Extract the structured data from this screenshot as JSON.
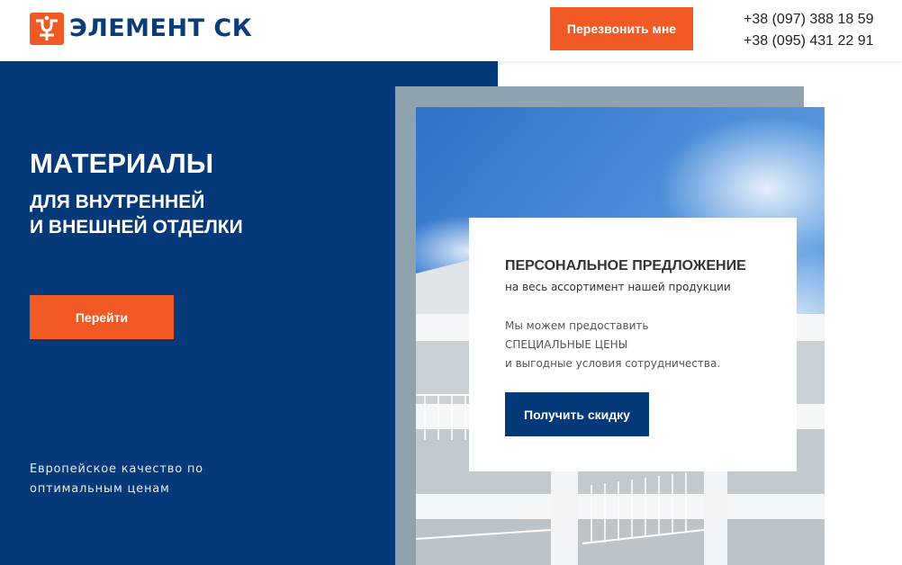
{
  "header": {
    "logo_text": "ЭЛЕМЕНТ СК",
    "callback_label": "Перезвонить мне",
    "phones": [
      "+38 (097) 388 18 59",
      "+38 (095) 431 22 91"
    ]
  },
  "hero": {
    "title": "МАТЕРИАЛЫ",
    "subtitle_lines": [
      "ДЛЯ ВНУТРЕННЕЙ",
      "И ВНЕШНЕЙ ОТДЕЛКИ"
    ],
    "go_label": "Перейти",
    "note_lines": [
      "Европейское качество по",
      "оптимальным ценам"
    ]
  },
  "offer": {
    "title": "ПЕРСОНАЛЬНОЕ ПРЕДЛОЖЕНИЕ",
    "subtitle": "на весь ассортимент нашей продукции",
    "text_lines": [
      "Мы можем предоставить",
      "СПЕЦИАЛЬНЫЕ ЦЕНЫ",
      "и выгодные условия сотрудничества."
    ],
    "button_label": "Получить скидку"
  },
  "colors": {
    "accent": "#f15a24",
    "brand_blue": "#053979",
    "frame_gray": "#8ea3ad"
  },
  "icons": {
    "logo": "element-sk-logo-icon"
  }
}
